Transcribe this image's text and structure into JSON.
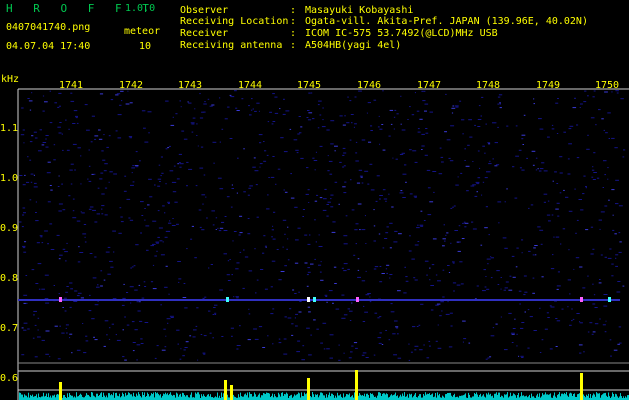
{
  "app": {
    "name": "H R O F F T",
    "version": "1.0.0"
  },
  "file": {
    "name": "0407041740.png",
    "datetime": "04.07.04 17:40"
  },
  "meteor": {
    "label": "meteor",
    "count": "10"
  },
  "header": {
    "separator": ":",
    "rows": [
      {
        "label": "Observer",
        "value": "Masayuki Kobayashi"
      },
      {
        "label": "Receiving Location",
        "value": "Ogata-vill. Akita-Pref. JAPAN (139.96E, 40.02N)"
      },
      {
        "label": "Receiver",
        "value": "ICOM IC-575 53.7492(@LCD)MHz USB"
      },
      {
        "label": "Receiving antenna",
        "value": "A504HB(yagi 4el)"
      }
    ]
  },
  "axis": {
    "y_unit": "kHz",
    "x_ticks": [
      "1741",
      "1742",
      "1743",
      "1744",
      "1745",
      "1746",
      "1747",
      "1748",
      "1749",
      "1750"
    ],
    "y_ticks": [
      "1.1",
      "1.0",
      "0.9",
      "0.8",
      "0.7",
      "0.6"
    ]
  },
  "colors": {
    "text": "#ffff00",
    "logo": "#00c850",
    "signal": "#00ffff",
    "noise": "#1a1aa0",
    "grid": "#d0d0d0"
  }
}
